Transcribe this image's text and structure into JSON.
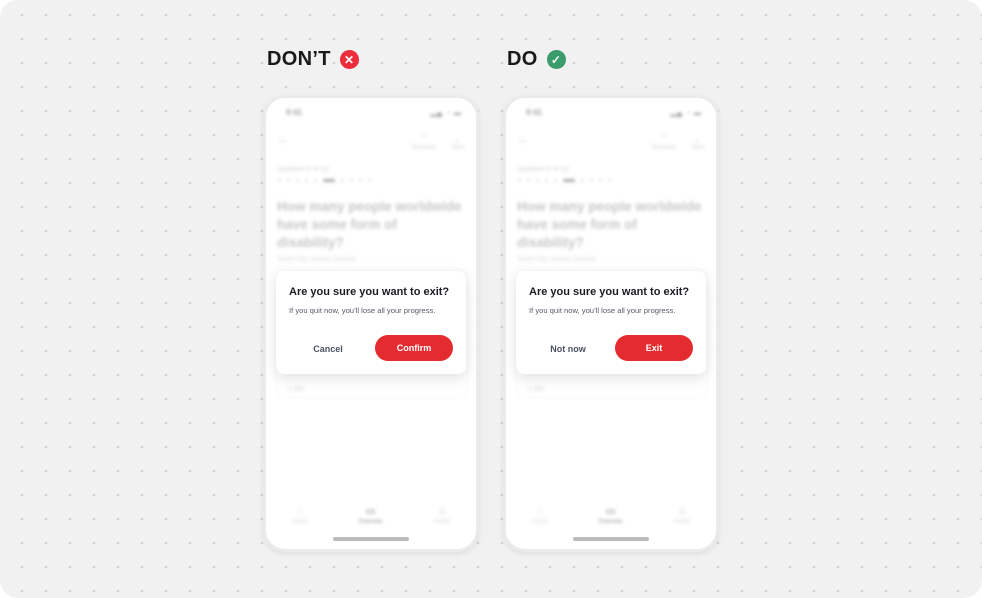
{
  "colors": {
    "bad": "#ec2b3b",
    "good": "#3a9b6d",
    "primary_button": "#e32b30"
  },
  "panels": [
    {
      "header": "DON’T",
      "badge_icon": "x-icon",
      "badge_glyph": "✕",
      "phone": {
        "time": "9:41",
        "prev": "Previous",
        "next": "Next",
        "question_label": "Question 6 of 10",
        "question": "How many people worldwide have some form of disability?",
        "instruction": "Select the correct answer",
        "option": "1.4%",
        "tabs": [
          "Home",
          "Courses",
          "Profile"
        ]
      },
      "dialog": {
        "title": "Are you sure you want to exit?",
        "message": "If you quit now, you’ll lose all your progress.",
        "secondary": "Cancel",
        "primary": "Confirm"
      }
    },
    {
      "header": "DO",
      "badge_icon": "check-icon",
      "badge_glyph": "✓",
      "phone": {
        "time": "9:41",
        "prev": "Previous",
        "next": "Next",
        "question_label": "Question 6 of 10",
        "question": "How many people worldwide have some form of disability?",
        "instruction": "Select the correct answer",
        "option": "1.4%",
        "tabs": [
          "Home",
          "Courses",
          "Profile"
        ]
      },
      "dialog": {
        "title": "Are you sure you want to exit?",
        "message": "If you quit now, you’ll lose all your progress.",
        "secondary": "Not now",
        "primary": "Exit"
      }
    }
  ]
}
